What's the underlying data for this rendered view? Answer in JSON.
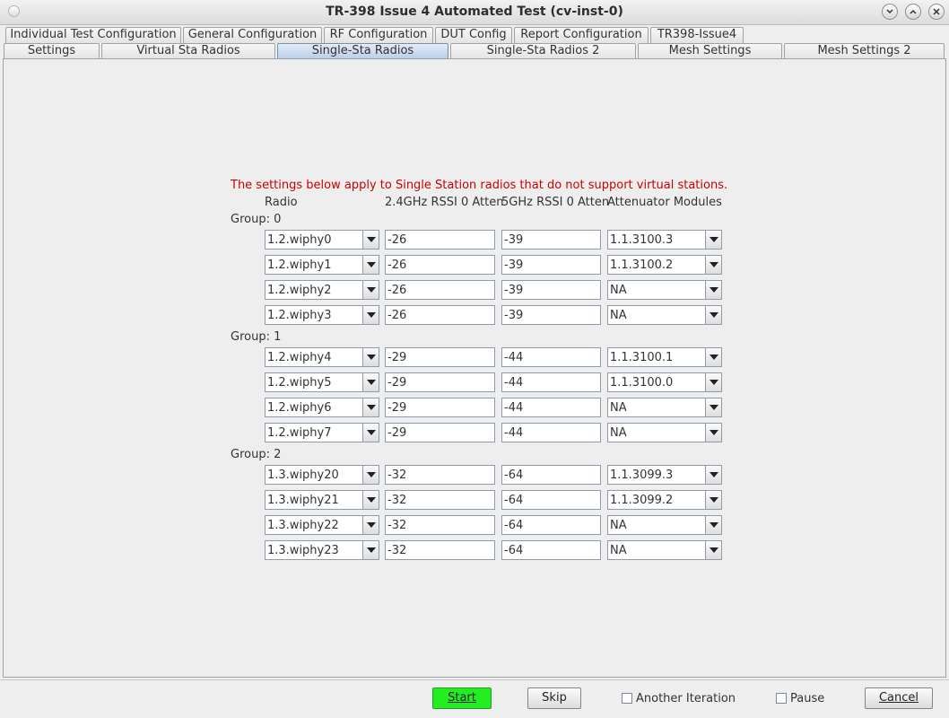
{
  "window": {
    "title": "TR-398 Issue 4 Automated Test  (cv-inst-0)"
  },
  "tabs_row1": [
    {
      "label": "Individual Test Configuration"
    },
    {
      "label": "General Configuration"
    },
    {
      "label": "RF Configuration"
    },
    {
      "label": "DUT Config"
    },
    {
      "label": "Report Configuration"
    },
    {
      "label": "TR398-Issue4"
    }
  ],
  "tabs_row2": [
    {
      "label": "Settings"
    },
    {
      "label": "Virtual Sta Radios"
    },
    {
      "label": "Single-Sta Radios",
      "selected": true
    },
    {
      "label": "Single-Sta Radios 2"
    },
    {
      "label": "Mesh Settings"
    },
    {
      "label": "Mesh Settings 2"
    }
  ],
  "content": {
    "notice": "The settings below apply to Single Station radios that do not support virtual stations.",
    "headers": {
      "radio": "Radio",
      "rssi24": "2.4GHz RSSI 0 Atten",
      "rssi5": "5GHz RSSI 0 Atten",
      "atten": "Attenuator Modules"
    },
    "groups": [
      {
        "label": "Group: 0",
        "rows": [
          {
            "radio": "1.2.wiphy0",
            "rssi24": "-26",
            "rssi5": "-39",
            "atten": "1.1.3100.3"
          },
          {
            "radio": "1.2.wiphy1",
            "rssi24": "-26",
            "rssi5": "-39",
            "atten": "1.1.3100.2"
          },
          {
            "radio": "1.2.wiphy2",
            "rssi24": "-26",
            "rssi5": "-39",
            "atten": "NA"
          },
          {
            "radio": "1.2.wiphy3",
            "rssi24": "-26",
            "rssi5": "-39",
            "atten": "NA"
          }
        ]
      },
      {
        "label": "Group: 1",
        "rows": [
          {
            "radio": "1.2.wiphy4",
            "rssi24": "-29",
            "rssi5": "-44",
            "atten": "1.1.3100.1"
          },
          {
            "radio": "1.2.wiphy5",
            "rssi24": "-29",
            "rssi5": "-44",
            "atten": "1.1.3100.0"
          },
          {
            "radio": "1.2.wiphy6",
            "rssi24": "-29",
            "rssi5": "-44",
            "atten": "NA"
          },
          {
            "radio": "1.2.wiphy7",
            "rssi24": "-29",
            "rssi5": "-44",
            "atten": "NA"
          }
        ]
      },
      {
        "label": "Group: 2",
        "rows": [
          {
            "radio": "1.3.wiphy20",
            "rssi24": "-32",
            "rssi5": "-64",
            "atten": "1.1.3099.3"
          },
          {
            "radio": "1.3.wiphy21",
            "rssi24": "-32",
            "rssi5": "-64",
            "atten": "1.1.3099.2"
          },
          {
            "radio": "1.3.wiphy22",
            "rssi24": "-32",
            "rssi5": "-64",
            "atten": "NA"
          },
          {
            "radio": "1.3.wiphy23",
            "rssi24": "-32",
            "rssi5": "-64",
            "atten": "NA"
          }
        ]
      }
    ]
  },
  "footer": {
    "start": "Start",
    "skip": "Skip",
    "another_iteration": "Another Iteration",
    "pause": "Pause",
    "cancel": "Cancel"
  },
  "colors": {
    "notice": "#cc0000",
    "start_button": "#22ee22",
    "selected_tab": "#b9cde7"
  },
  "icons": [
    "window-menu-icon",
    "minimize-icon",
    "maximize-icon",
    "dropdown-arrow-icon"
  ]
}
